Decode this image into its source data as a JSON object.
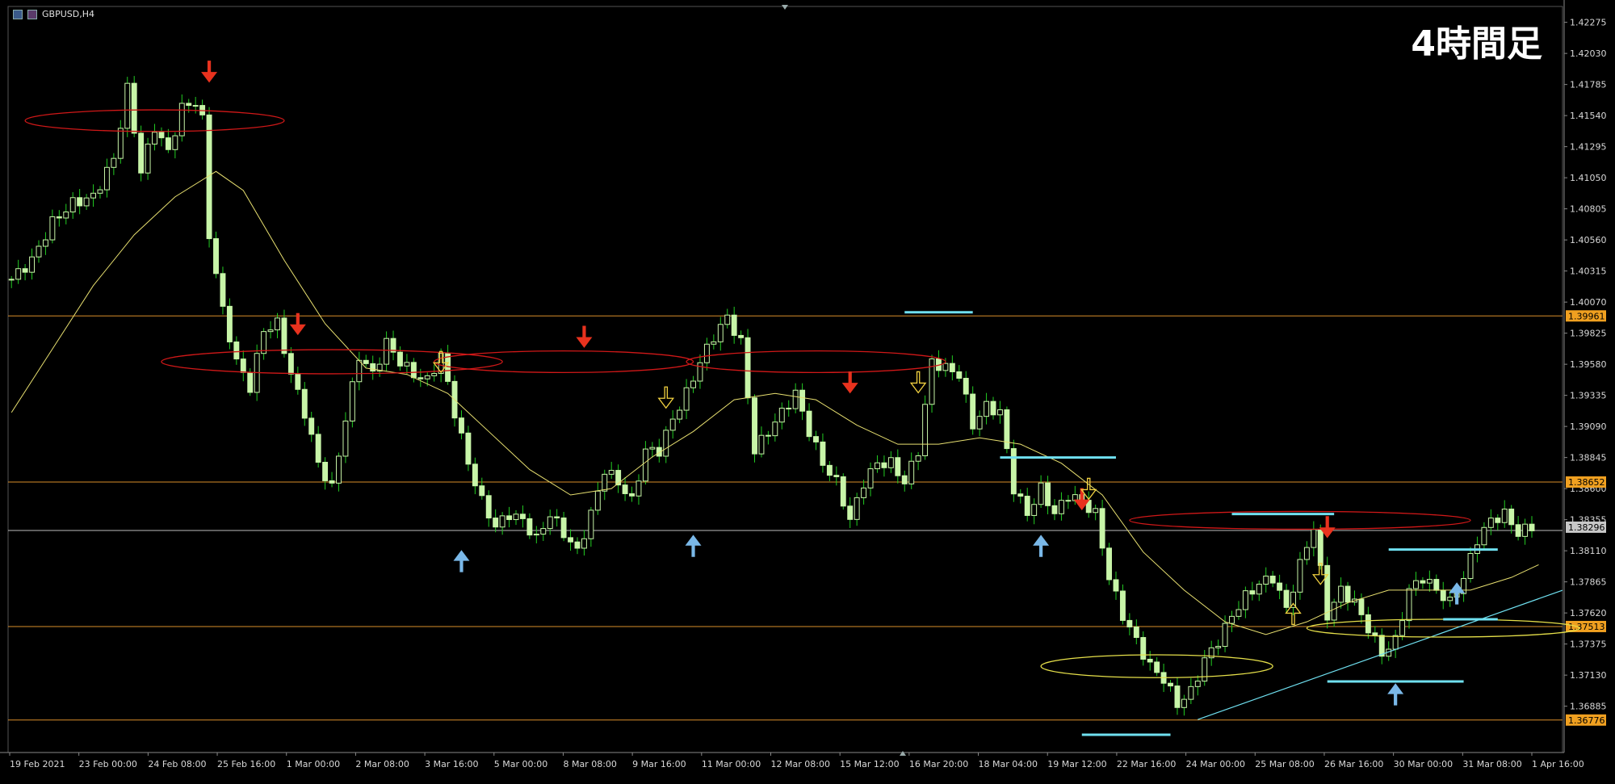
{
  "window": {
    "symbol": "GBPUSD,H4",
    "timeframe_label": "4時間足"
  },
  "colors": {
    "background": "#000000",
    "bull": "#c8f5a8",
    "bear": "#c8f5a8",
    "wick": "#22cc22",
    "ma": "#e8e070",
    "hline": "#d98e2a",
    "redArrow": "#e8321e",
    "blueArrow": "#7ab8e8",
    "yellowArrow": "#f0d040",
    "redEllipse": "#d01818",
    "yellowEllipse": "#e6e04a",
    "cyan": "#6fe0f0",
    "priceTag": "#f0a020"
  },
  "chart_data": {
    "type": "candlestick",
    "title": "GBPUSD,H4",
    "ylim": [
      1.3652,
      1.424
    ],
    "y_ticks": [
      "1.42275",
      "1.42030",
      "1.41785",
      "1.41540",
      "1.41295",
      "1.41050",
      "1.40805",
      "1.40560",
      "1.40315",
      "1.40070",
      "1.39825",
      "1.39580",
      "1.39335",
      "1.39090",
      "1.38845",
      "1.38600",
      "1.38355",
      "1.38110",
      "1.37865",
      "1.37620",
      "1.37375",
      "1.37130",
      "1.36885"
    ],
    "x_labels": [
      "19 Feb 2021",
      "23 Feb 00:00",
      "24 Feb 08:00",
      "25 Feb 16:00",
      "1 Mar 00:00",
      "2 Mar 08:00",
      "3 Mar 16:00",
      "5 Mar 00:00",
      "8 Mar 08:00",
      "9 Mar 16:00",
      "11 Mar 00:00",
      "12 Mar 08:00",
      "15 Mar 12:00",
      "16 Mar 20:00",
      "18 Mar 04:00",
      "19 Mar 12:00",
      "22 Mar 16:00",
      "24 Mar 00:00",
      "25 Mar 08:00",
      "26 Mar 16:00",
      "30 Mar 00:00",
      "31 Mar 08:00",
      "1 Apr 16:00"
    ],
    "horizontal_levels": [
      {
        "price": 1.39961,
        "label": "1.39961"
      },
      {
        "price": 1.38652,
        "label": "1.38652"
      },
      {
        "price": 1.37513,
        "label": "1.37513"
      },
      {
        "price": 1.36776,
        "label": "1.36776"
      },
      {
        "price": 1.3827,
        "label": ""
      }
    ],
    "current_price": {
      "price": 1.38296,
      "label": "1.38296"
    },
    "ohlc_pivots": [
      [
        0,
        1.4025
      ],
      [
        3,
        1.404
      ],
      [
        6,
        1.407
      ],
      [
        9,
        1.4085
      ],
      [
        12,
        1.409
      ],
      [
        15,
        1.412
      ],
      [
        17,
        1.4175
      ],
      [
        19,
        1.411
      ],
      [
        21,
        1.4145
      ],
      [
        23,
        1.4125
      ],
      [
        25,
        1.416
      ],
      [
        27,
        1.4165
      ],
      [
        28,
        1.415
      ],
      [
        29,
        1.406
      ],
      [
        31,
        1.4
      ],
      [
        33,
        1.396
      ],
      [
        35,
        1.394
      ],
      [
        37,
        1.3985
      ],
      [
        39,
        1.399
      ],
      [
        41,
        1.395
      ],
      [
        43,
        1.392
      ],
      [
        45,
        1.388
      ],
      [
        47,
        1.386
      ],
      [
        49,
        1.3915
      ],
      [
        51,
        1.3965
      ],
      [
        53,
        1.395
      ],
      [
        55,
        1.3975
      ],
      [
        57,
        1.396
      ],
      [
        59,
        1.395
      ],
      [
        61,
        1.3945
      ],
      [
        63,
        1.3965
      ],
      [
        65,
        1.392
      ],
      [
        67,
        1.388
      ],
      [
        69,
        1.385
      ],
      [
        71,
        1.383
      ],
      [
        73,
        1.384
      ],
      [
        75,
        1.3835
      ],
      [
        77,
        1.382
      ],
      [
        79,
        1.384
      ],
      [
        81,
        1.3825
      ],
      [
        83,
        1.381
      ],
      [
        85,
        1.384
      ],
      [
        87,
        1.3875
      ],
      [
        89,
        1.3865
      ],
      [
        91,
        1.385
      ],
      [
        93,
        1.389
      ],
      [
        95,
        1.389
      ],
      [
        97,
        1.3915
      ],
      [
        99,
        1.3935
      ],
      [
        101,
        1.396
      ],
      [
        103,
        1.398
      ],
      [
        105,
        1.3995
      ],
      [
        107,
        1.3975
      ],
      [
        109,
        1.389
      ],
      [
        111,
        1.3905
      ],
      [
        113,
        1.392
      ],
      [
        115,
        1.3935
      ],
      [
        117,
        1.3905
      ],
      [
        119,
        1.388
      ],
      [
        121,
        1.3865
      ],
      [
        123,
        1.3835
      ],
      [
        125,
        1.3865
      ],
      [
        127,
        1.388
      ],
      [
        129,
        1.388
      ],
      [
        131,
        1.3865
      ],
      [
        133,
        1.389
      ],
      [
        135,
        1.396
      ],
      [
        137,
        1.3955
      ],
      [
        139,
        1.395
      ],
      [
        141,
        1.391
      ],
      [
        143,
        1.3925
      ],
      [
        145,
        1.392
      ],
      [
        147,
        1.386
      ],
      [
        149,
        1.384
      ],
      [
        151,
        1.386
      ],
      [
        153,
        1.384
      ],
      [
        155,
        1.3855
      ],
      [
        157,
        1.385
      ],
      [
        159,
        1.384
      ],
      [
        161,
        1.379
      ],
      [
        163,
        1.376
      ],
      [
        165,
        1.374
      ],
      [
        167,
        1.372
      ],
      [
        169,
        1.371
      ],
      [
        171,
        1.369
      ],
      [
        173,
        1.37
      ],
      [
        175,
        1.3725
      ],
      [
        177,
        1.374
      ],
      [
        179,
        1.376
      ],
      [
        181,
        1.3775
      ],
      [
        183,
        1.3785
      ],
      [
        185,
        1.379
      ],
      [
        187,
        1.3765
      ],
      [
        189,
        1.38
      ],
      [
        191,
        1.383
      ],
      [
        193,
        1.376
      ],
      [
        195,
        1.378
      ],
      [
        197,
        1.377
      ],
      [
        199,
        1.375
      ],
      [
        201,
        1.373
      ],
      [
        203,
        1.374
      ],
      [
        205,
        1.378
      ],
      [
        207,
        1.379
      ],
      [
        209,
        1.378
      ],
      [
        211,
        1.377
      ],
      [
        213,
        1.379
      ],
      [
        215,
        1.382
      ],
      [
        217,
        1.3835
      ],
      [
        219,
        1.384
      ],
      [
        221,
        1.3825
      ],
      [
        223,
        1.383
      ]
    ],
    "moving_average": [
      [
        0,
        1.392
      ],
      [
        6,
        1.397
      ],
      [
        12,
        1.402
      ],
      [
        18,
        1.406
      ],
      [
        24,
        1.409
      ],
      [
        30,
        1.411
      ],
      [
        34,
        1.4095
      ],
      [
        40,
        1.404
      ],
      [
        46,
        1.399
      ],
      [
        52,
        1.3955
      ],
      [
        58,
        1.395
      ],
      [
        64,
        1.3935
      ],
      [
        70,
        1.3905
      ],
      [
        76,
        1.3875
      ],
      [
        82,
        1.3855
      ],
      [
        88,
        1.386
      ],
      [
        94,
        1.3885
      ],
      [
        100,
        1.3905
      ],
      [
        106,
        1.393
      ],
      [
        112,
        1.3935
      ],
      [
        118,
        1.393
      ],
      [
        124,
        1.391
      ],
      [
        130,
        1.3895
      ],
      [
        136,
        1.3895
      ],
      [
        142,
        1.39
      ],
      [
        148,
        1.3895
      ],
      [
        154,
        1.388
      ],
      [
        160,
        1.3855
      ],
      [
        166,
        1.381
      ],
      [
        172,
        1.378
      ],
      [
        178,
        1.3755
      ],
      [
        184,
        1.3745
      ],
      [
        190,
        1.3755
      ],
      [
        196,
        1.377
      ],
      [
        202,
        1.378
      ],
      [
        208,
        1.378
      ],
      [
        214,
        1.378
      ],
      [
        220,
        1.379
      ],
      [
        224,
        1.38
      ]
    ],
    "red_ellipses": [
      {
        "cx_bar": 21,
        "cy": 1.415,
        "rx_bars": 19,
        "ry": 0.00085
      },
      {
        "cx_bar": 47,
        "cy": 1.396,
        "rx_bars": 25,
        "ry": 0.00095
      },
      {
        "cx_bar": 81,
        "cy": 1.396,
        "rx_bars": 19,
        "ry": 0.00085
      },
      {
        "cx_bar": 118,
        "cy": 1.396,
        "rx_bars": 19,
        "ry": 0.00085
      },
      {
        "cx_bar": 189,
        "cy": 1.3835,
        "rx_bars": 25,
        "ry": 0.0007
      }
    ],
    "yellow_ellipses": [
      {
        "cx_bar": 168,
        "cy": 1.372,
        "rx_bars": 17,
        "ry": 0.0009
      },
      {
        "cx_bar": 210,
        "cy": 1.375,
        "rx_bars": 20,
        "ry": 0.0007
      }
    ],
    "red_arrows": [
      [
        29,
        1.4197
      ],
      [
        42,
        1.3998
      ],
      [
        84,
        1.3988
      ],
      [
        123,
        1.3952
      ],
      [
        157,
        1.386
      ],
      [
        193,
        1.3838
      ]
    ],
    "blue_arrows": [
      [
        66,
        1.37945
      ],
      [
        100,
        1.38065
      ],
      [
        151,
        1.38065
      ],
      [
        203,
        1.36895
      ],
      [
        212,
        1.3769
      ]
    ],
    "yellow_arrows": [
      [
        63,
        1.3963
      ],
      [
        96,
        1.3935
      ],
      [
        133,
        1.3947
      ],
      [
        158,
        1.3863
      ],
      [
        188,
        1.3758
      ],
      [
        192,
        1.3796
      ]
    ],
    "cyan_segments": [
      [
        131,
        141,
        1.3999
      ],
      [
        145,
        162,
        1.38845
      ],
      [
        179,
        194,
        1.384
      ],
      [
        202,
        218,
        1.3812
      ],
      [
        193,
        213,
        1.3708
      ],
      [
        157,
        170,
        1.3666
      ],
      [
        210,
        218,
        1.3757
      ]
    ],
    "trendline": [
      [
        174,
        1.3678
      ],
      [
        227,
        1.3778
      ]
    ]
  }
}
